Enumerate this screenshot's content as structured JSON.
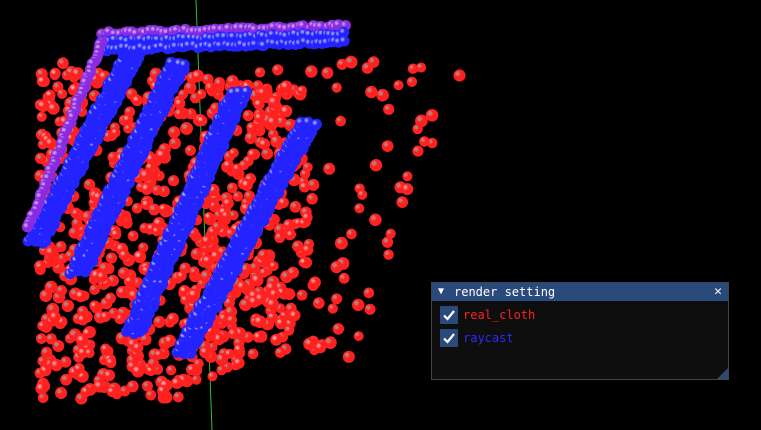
{
  "window": {
    "title": "render setting",
    "collapse_icon": "triangle-down-icon",
    "close_icon": "close-icon"
  },
  "options": [
    {
      "label": "real_cloth",
      "checked": true,
      "color": "#ff2020"
    },
    {
      "label": "raycast",
      "checked": true,
      "color": "#2a2aff"
    }
  ],
  "colors": {
    "background": "#000000",
    "particle_red": "#ff2020",
    "particle_blue": "#2323ff",
    "particle_purple": "#8a2be2",
    "axis": "#2fbf2f",
    "titlebar": "#294a7a",
    "checkmark": "#ffffff"
  }
}
